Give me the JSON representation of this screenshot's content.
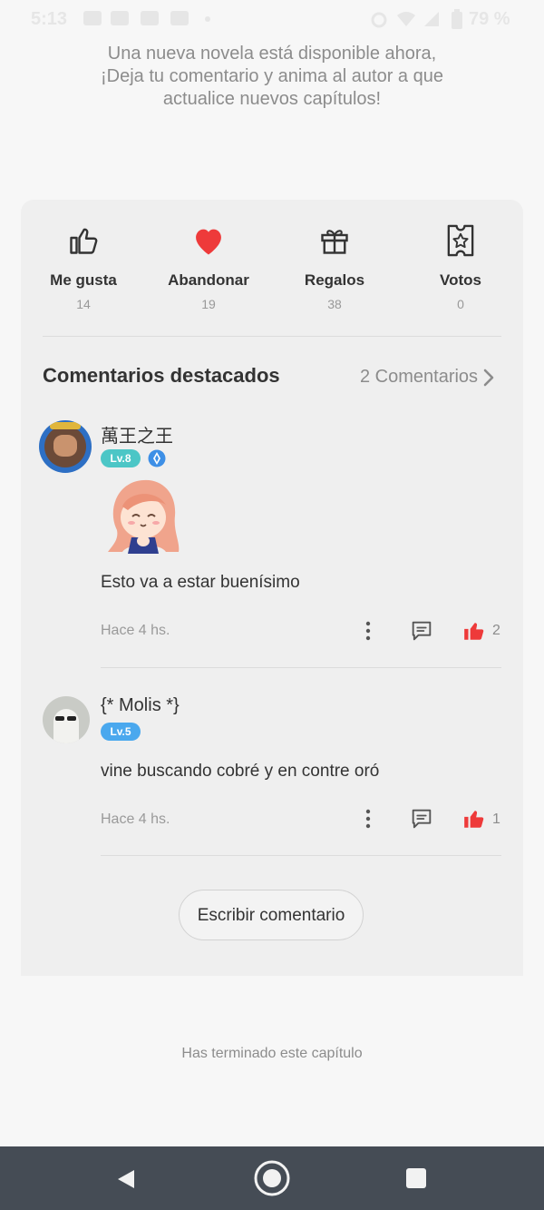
{
  "status_bar": {
    "time": "5:13",
    "battery": "79 %"
  },
  "notice": {
    "line1": "Una nueva novela está disponible ahora,",
    "line2": "¡Deja tu comentario y anima al autor a que",
    "line3": "actualice nuevos capítulos!"
  },
  "stats": [
    {
      "label": "Me gusta",
      "count": "14",
      "icon": "thumbs-up-outline-icon"
    },
    {
      "label": "Abandonar",
      "count": "19",
      "icon": "heart-filled-icon"
    },
    {
      "label": "Regalos",
      "count": "38",
      "icon": "gift-icon"
    },
    {
      "label": "Votos",
      "count": "0",
      "icon": "ticket-star-icon"
    }
  ],
  "comments_section": {
    "title": "Comentarios destacados",
    "link": "2 Comentarios"
  },
  "comments": [
    {
      "user": "萬王之王",
      "level": "Lv.8",
      "text": "Esto va a estar buenísimo",
      "time": "Hace 4 hs.",
      "likes": "2"
    },
    {
      "user": "{* Molis *}",
      "level": "Lv.5",
      "text": "vine buscando cobré y en contre oró",
      "time": "Hace 4 hs.",
      "likes": "1"
    }
  ],
  "write_button": "Escribir comentario",
  "end_text": "Has terminado este capítulo",
  "colors": {
    "accent_red": "#ee3a3a",
    "level8": "#4cc6c6",
    "level5": "#4aa8ee",
    "navbar": "#454c55"
  }
}
